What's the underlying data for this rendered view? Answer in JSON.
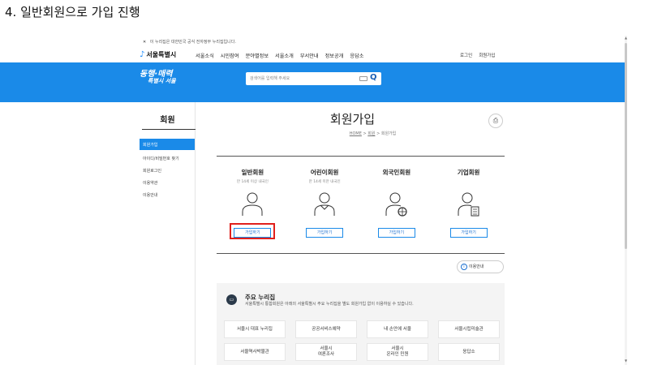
{
  "caption": "4. 일반회원으로 가입 진행",
  "gov_notice": "이 누리집은 대한민국 공식 전자정부 누리집입니다.",
  "header": {
    "logo": "서울특별시",
    "menu": [
      "서울소식",
      "시민참여",
      "분야별정보",
      "서울소개",
      "부서안내",
      "정보공개",
      "응답소"
    ],
    "login": "로그인",
    "signup": "회원가입"
  },
  "banner": {
    "slogan_line1": "동행·매력",
    "slogan_line2": "특별시 서울",
    "search_placeholder": "검색어를 입력해 주세요"
  },
  "sidebar": {
    "title": "회원",
    "items": [
      "회원가입",
      "아이디/비밀번호 찾기",
      "회원로그인",
      "이용약관",
      "이용안내"
    ],
    "active_index": 0
  },
  "page": {
    "title": "회원가입",
    "breadcrumb": [
      "HOME",
      "회원",
      "회원가입"
    ]
  },
  "member_types": [
    {
      "title": "일반회원",
      "sub": "만 14세 이상 내국인",
      "button": "가입하기",
      "icon": "person-icon"
    },
    {
      "title": "어린이회원",
      "sub": "만 14세 미만 내국인",
      "button": "가입하기",
      "icon": "child-icon"
    },
    {
      "title": "외국인회원",
      "sub": "",
      "button": "가입하기",
      "icon": "person-globe-icon"
    },
    {
      "title": "기업회원",
      "sub": "",
      "button": "가입하기",
      "icon": "person-building-icon"
    }
  ],
  "guide_button": "이용안내",
  "portals": {
    "title": "주요 누리집",
    "desc": "서울특별시 통합회원은 아래의 서울특별시 주요 누리집을 별도 회원가입 없이 이용하실 수 있습니다.",
    "links": [
      "서울시 대표 누리집",
      "공공서비스예약",
      "내 손안에 서울",
      "서울시립미술관",
      "서울역사박물관",
      "서울시\n여론조사",
      "서울시\n온라인 민원",
      "응답소"
    ]
  },
  "colors": {
    "brand_blue": "#1a8ae8",
    "highlight_red": "#e0201c"
  }
}
